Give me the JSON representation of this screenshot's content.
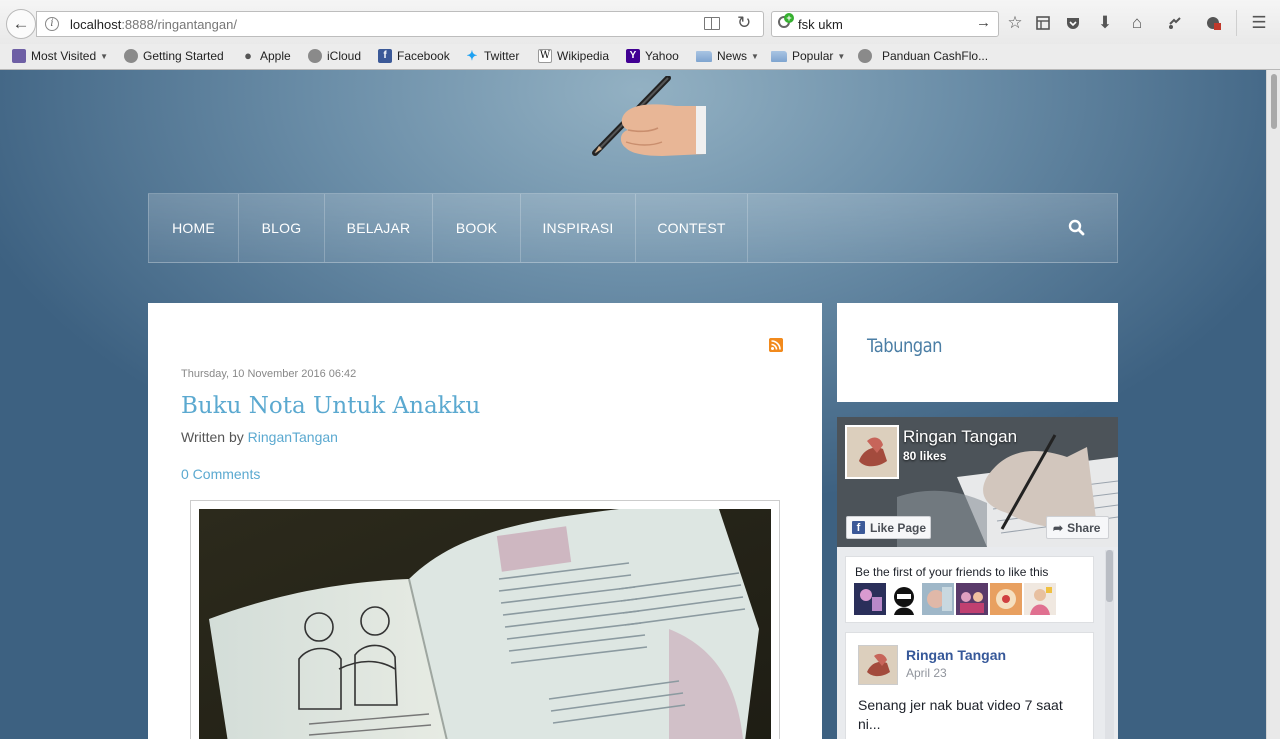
{
  "browser": {
    "url_host": "localhost",
    "url_rest": ":8888/ringantangan/",
    "search_text": "fsk ukm"
  },
  "bookmarks": [
    {
      "label": "Most Visited",
      "icon": "most-visited-icon",
      "has_menu": true
    },
    {
      "label": "Getting Started",
      "icon": "globe-icon"
    },
    {
      "label": "Apple",
      "icon": "apple-icon"
    },
    {
      "label": "iCloud",
      "icon": "globe-icon"
    },
    {
      "label": "Facebook",
      "icon": "facebook-icon"
    },
    {
      "label": "Twitter",
      "icon": "twitter-icon"
    },
    {
      "label": "Wikipedia",
      "icon": "wikipedia-icon"
    },
    {
      "label": "Yahoo",
      "icon": "yahoo-icon"
    },
    {
      "label": "News",
      "icon": "folder-icon",
      "has_menu": true
    },
    {
      "label": "Popular",
      "icon": "folder-icon",
      "has_menu": true
    },
    {
      "label": "Panduan CashFlo...",
      "icon": "globe-icon"
    }
  ],
  "nav": {
    "items": [
      "HOME",
      "BLOG",
      "BELAJAR",
      "BOOK",
      "INSPIRASI",
      "CONTEST"
    ]
  },
  "post": {
    "date": "Thursday, 10 November 2016 06:42",
    "title": "Buku Nota Untuk Anakku",
    "written_by": "Written by ",
    "author": "RinganTangan",
    "comments": "0 Comments"
  },
  "sidebar": {
    "title": "Tabungan"
  },
  "facebook": {
    "page_name": "Ringan Tangan",
    "likes": "80 likes",
    "like_button": "Like Page",
    "share_button": "Share",
    "friends_text": "Be the first of your friends to like this",
    "post_author": "Ringan Tangan",
    "post_date": "April 23",
    "post_text": "Senang jer nak buat video 7 saat ni..."
  },
  "colors": {
    "link": "#5ba9d0",
    "sidebar_title": "#4b7ea5",
    "facebook_blue": "#3b5998"
  }
}
